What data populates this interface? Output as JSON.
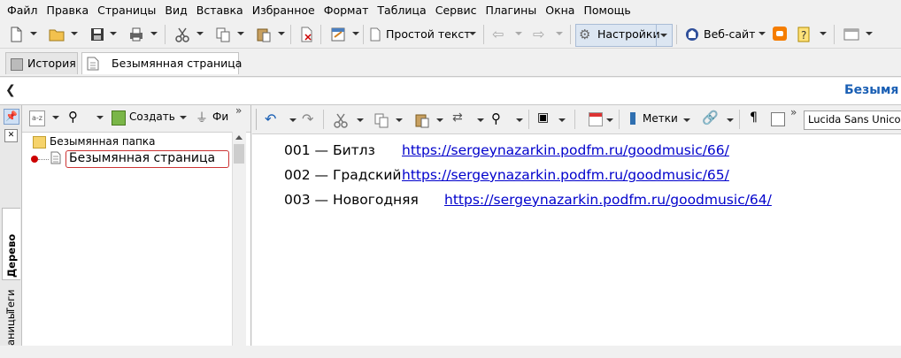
{
  "menu": [
    "Файл",
    "Правка",
    "Страницы",
    "Вид",
    "Вставка",
    "Избранное",
    "Формат",
    "Таблица",
    "Сервис",
    "Плагины",
    "Окна",
    "Помощь"
  ],
  "toolbar": {
    "style_label": "Простой текст",
    "settings_label": "Настройки",
    "website_label": "Веб-сайт"
  },
  "tabs": {
    "history": "История",
    "page": "Безымянная страница"
  },
  "title_strip": {
    "title": "Безымя"
  },
  "side_tabs": {
    "tree": "Дерево",
    "tags": "Теги",
    "pages": "аницы"
  },
  "tree_toolbar": {
    "create_label": "Создать",
    "filter_label": "Фи"
  },
  "tree": {
    "folder": "Безымянная папка",
    "page": "Безымянная страница"
  },
  "editor_toolbar": {
    "tags_label": "Метки",
    "font_value": "Lucida Sans Unicod"
  },
  "editor": {
    "lines": [
      {
        "label": "001 — Битлз",
        "url": "https://sergeynazarkin.podfm.ru/goodmusic/66/"
      },
      {
        "label": "002 — Градский",
        "url": "https://sergeynazarkin.podfm.ru/goodmusic/65/"
      },
      {
        "label": "003 — Новогодняя",
        "url": "https://sergeynazarkin.podfm.ru/goodmusic/64/"
      }
    ]
  },
  "colors": {
    "title_blue": "#1a5fb4",
    "link_blue": "#0000cc",
    "selection_red": "#cc0000",
    "settings_bg": "#dce6f2"
  }
}
